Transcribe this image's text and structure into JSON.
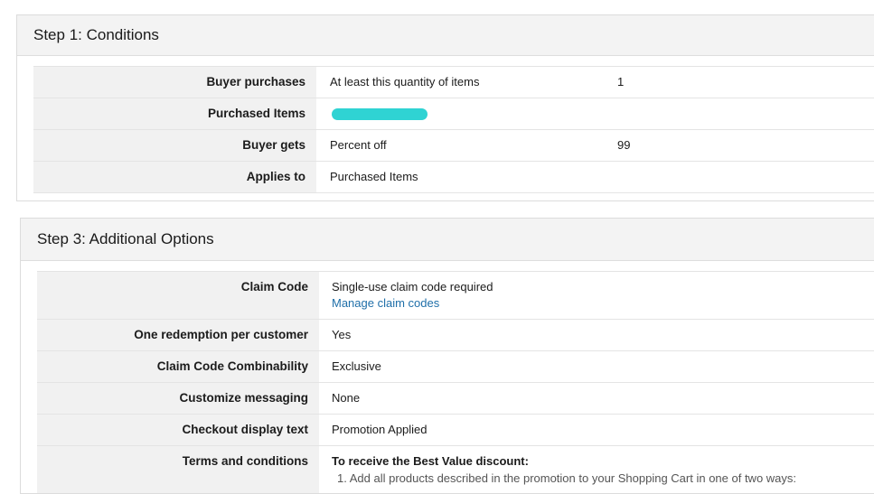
{
  "step1": {
    "title": "Step 1: Conditions",
    "rows": [
      {
        "label": "Buyer purchases",
        "value": "At least this quantity of items",
        "value2": "1"
      },
      {
        "label": "Purchased Items",
        "value": "",
        "value2": ""
      },
      {
        "label": "Buyer gets",
        "value": "Percent off",
        "value2": "99"
      },
      {
        "label": "Applies to",
        "value": "Purchased Items",
        "value2": ""
      }
    ],
    "redaction_color": "#2fd3d3"
  },
  "step3": {
    "title": "Step 3: Additional Options",
    "rows": [
      {
        "label": "Claim Code",
        "value": "Single-use claim code required",
        "link": "Manage claim codes"
      },
      {
        "label": "One redemption per customer",
        "value": "Yes"
      },
      {
        "label": "Claim Code Combinability",
        "value": "Exclusive"
      },
      {
        "label": "Customize messaging",
        "value": "None"
      },
      {
        "label": "Checkout display text",
        "value": "Promotion Applied"
      },
      {
        "label": "Terms and conditions",
        "value": "To receive the Best Value discount:",
        "subvalue": "1. Add all products described in the promotion to your Shopping Cart in one of two ways:"
      }
    ]
  },
  "colors": {
    "header_bg": "#f3f3f3",
    "label_bg": "#f1f1f1",
    "link": "#1f6fa9"
  }
}
